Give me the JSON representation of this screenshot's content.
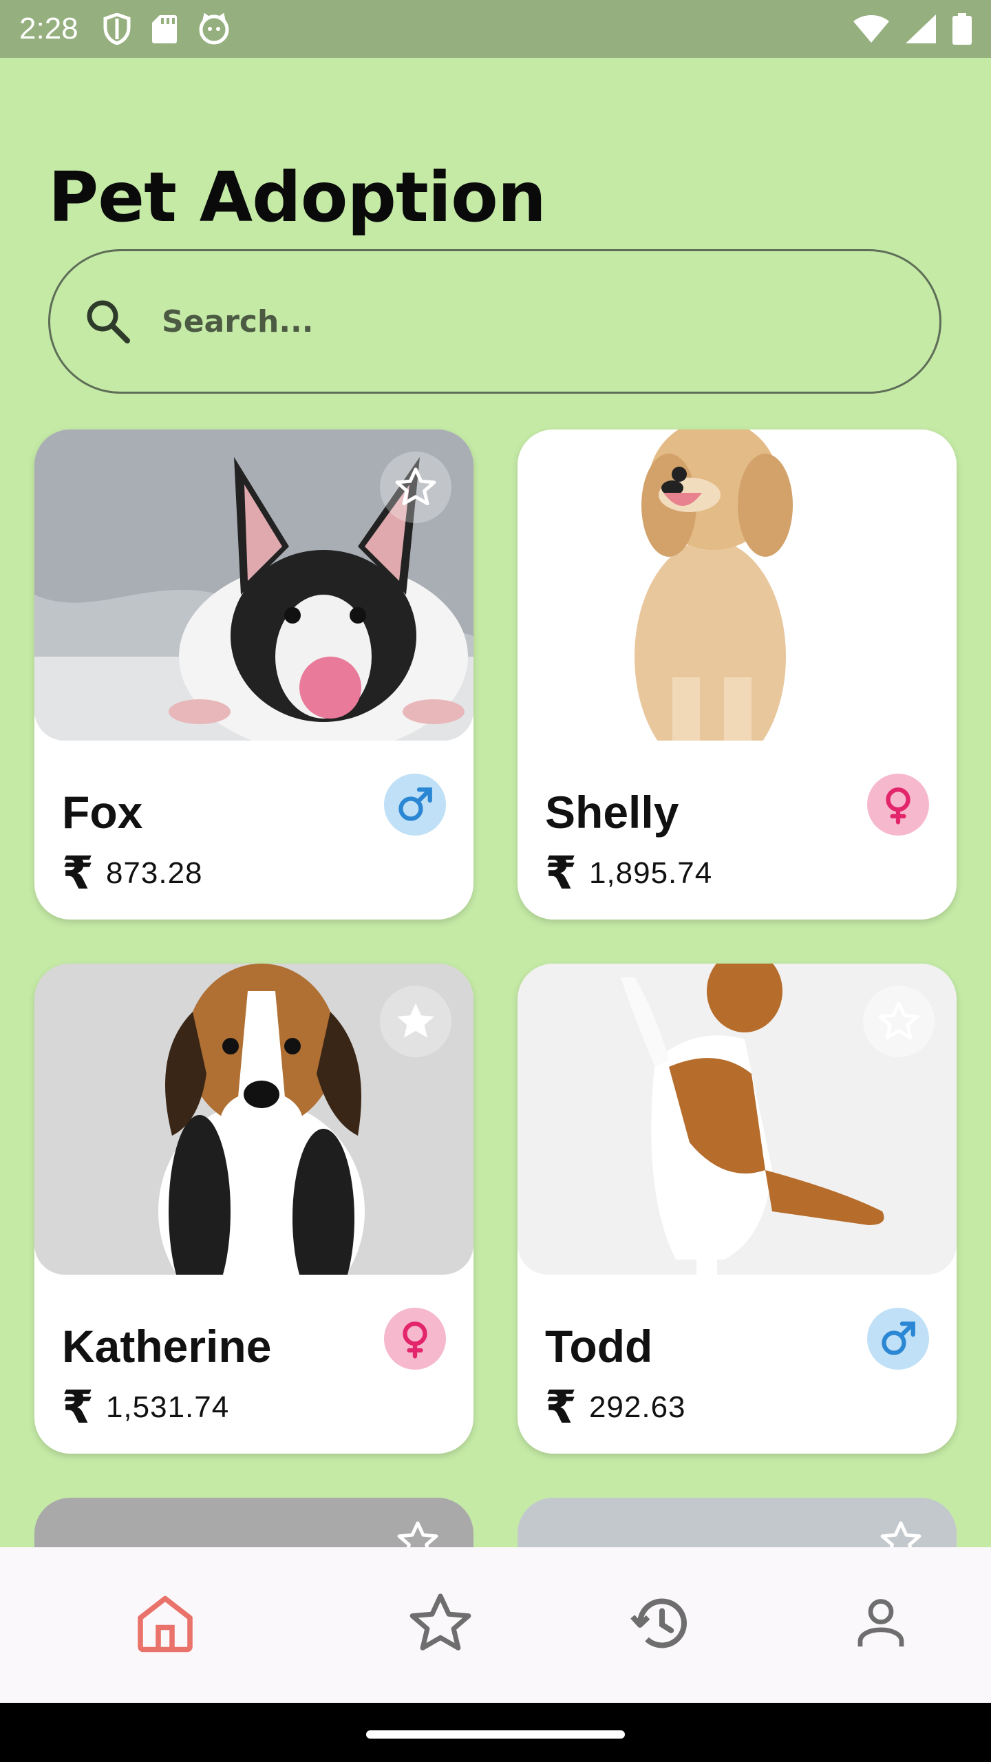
{
  "status_bar": {
    "time": "2:28"
  },
  "header": {
    "title": "Pet Adoption"
  },
  "search": {
    "placeholder": "Search..."
  },
  "currency_symbol": "₹",
  "pets": [
    {
      "name": "Fox",
      "price": "873.28",
      "gender": "male",
      "favorite": false
    },
    {
      "name": "Shelly",
      "price": "1,895.74",
      "gender": "female",
      "favorite": false
    },
    {
      "name": "Katherine",
      "price": "1,531.74",
      "gender": "female",
      "favorite": false
    },
    {
      "name": "Todd",
      "price": "292.63",
      "gender": "male",
      "favorite": false
    }
  ],
  "bottom_nav": {
    "items": [
      {
        "icon": "home-icon",
        "active": true
      },
      {
        "icon": "star-icon",
        "active": false
      },
      {
        "icon": "history-icon",
        "active": false
      },
      {
        "icon": "person-icon",
        "active": false
      }
    ]
  },
  "colors": {
    "background": "#c5eaa6",
    "status_bar": "#95b07e",
    "male_badge": "#bfe0f6",
    "male_symbol": "#2b87d4",
    "female_badge": "#f6b8cc",
    "female_symbol": "#e3256b",
    "nav_active": "#e9736a",
    "nav_inactive": "#6e6e6e"
  }
}
